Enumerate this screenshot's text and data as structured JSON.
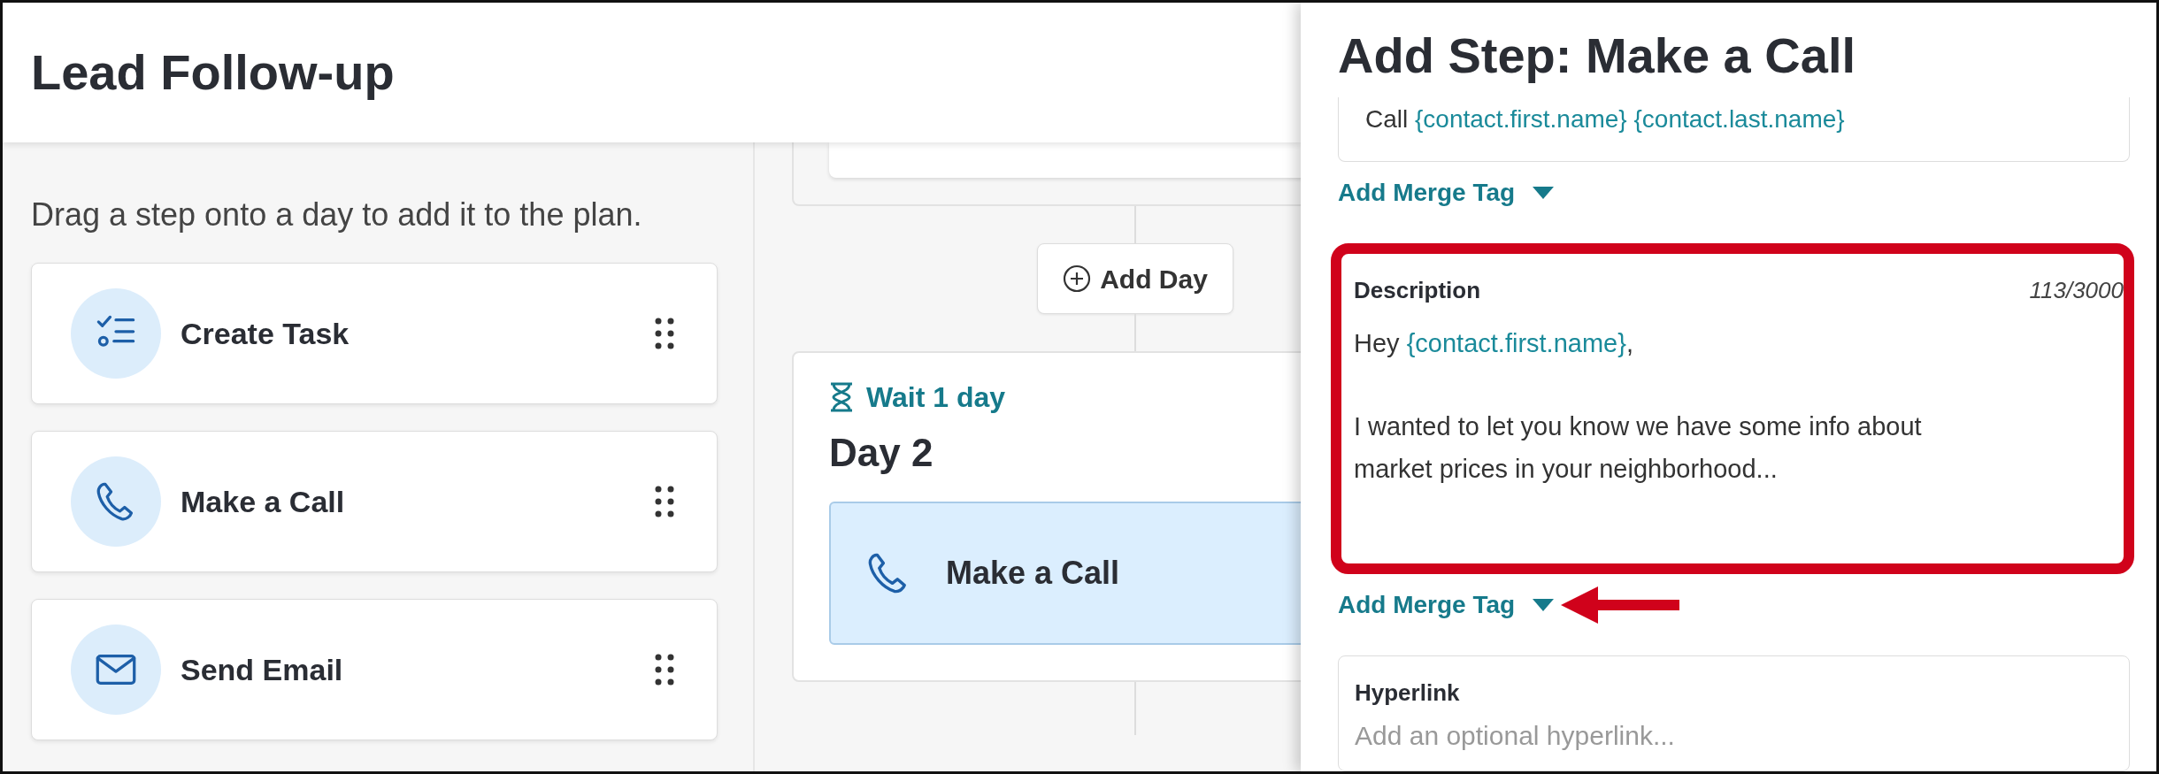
{
  "header": {
    "title": "Lead Follow-up"
  },
  "steps_panel": {
    "hint": "Drag a step onto a day to add it to the plan.",
    "steps": [
      {
        "label": "Create Task",
        "kind": "task"
      },
      {
        "label": "Make a Call",
        "kind": "call"
      },
      {
        "label": "Send Email",
        "kind": "email"
      }
    ]
  },
  "timeline": {
    "add_day": "Add Day",
    "day": {
      "wait": "Wait 1 day",
      "title": "Day 2",
      "steps": [
        {
          "label": "Make a Call",
          "kind": "call",
          "selected": true
        }
      ]
    }
  },
  "drawer": {
    "title": "Add Step: Make a Call",
    "subject": [
      {
        "text": "Call ",
        "kind": "plain"
      },
      {
        "text": "{contact.first.name} ",
        "kind": "tag"
      },
      {
        "text": "{contact.last.name}",
        "kind": "tag"
      }
    ],
    "merge_tags": [
      {
        "label": "Add Merge Tag",
        "pointed": false
      },
      {
        "label": "Add Merge Tag",
        "pointed": true
      }
    ],
    "description": {
      "label": "Description",
      "counter": "113/3000",
      "highlighted": true,
      "lines": [
        [
          {
            "text": "Hey ",
            "kind": "plain"
          },
          {
            "text": "{contact.first.name}",
            "kind": "tag"
          },
          {
            "text": ",",
            "kind": "plain"
          }
        ],
        [
          {
            "text": "I wanted to let you know we have some info about market prices in your neighborhood...",
            "kind": "plain"
          }
        ]
      ]
    },
    "hyperlink": {
      "label": "Hyperlink",
      "placeholder": "Add an optional hyperlink..."
    }
  }
}
